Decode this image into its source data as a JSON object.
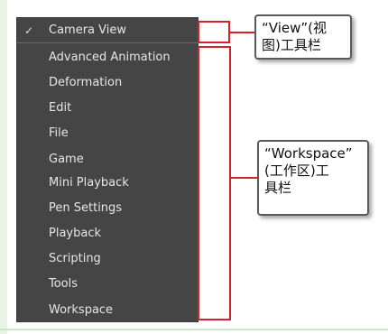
{
  "menu": {
    "items": [
      {
        "label": "Camera View",
        "checked": true,
        "check_glyph": "✓"
      },
      {
        "label": "Advanced Animation",
        "checked": false
      },
      {
        "label": "Deformation",
        "checked": false
      },
      {
        "label": "Edit",
        "checked": false
      },
      {
        "label": "File",
        "checked": false
      },
      {
        "label": "Game",
        "checked": false
      },
      {
        "label": "Mini Playback",
        "checked": false
      },
      {
        "label": "Pen Settings",
        "checked": false
      },
      {
        "label": "Playback",
        "checked": false
      },
      {
        "label": "Scripting",
        "checked": false
      },
      {
        "label": "Tools",
        "checked": false
      },
      {
        "label": "Workspace",
        "checked": false
      }
    ]
  },
  "callouts": {
    "view_toolbar": "“View”(视\n图)工具栏",
    "workspace_toolbar": "“Workspace”\n(工作区)工\n具栏"
  },
  "colors": {
    "menu_background": "#454545",
    "menu_text": "#e6e6e6",
    "highlight_red": "#d8202a",
    "callout_border": "#5a5a5a"
  }
}
